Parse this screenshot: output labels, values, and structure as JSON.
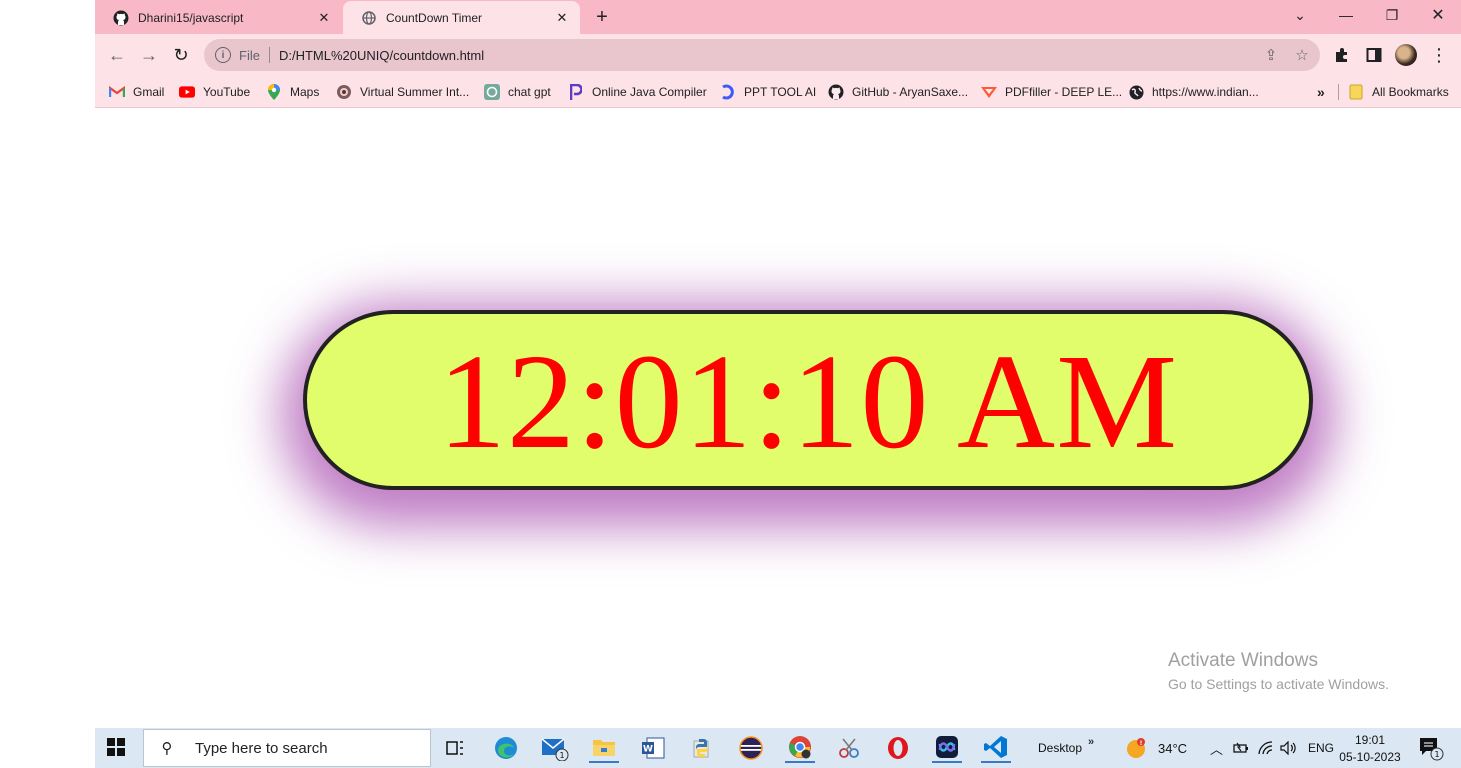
{
  "browser": {
    "tabs": [
      {
        "title": "Dharini15/javascript",
        "icon": "github-icon"
      },
      {
        "title": "CountDown Timer",
        "icon": "globe-icon"
      }
    ],
    "omnibox": {
      "scheme": "File",
      "url": "D:/HTML%20UNIQ/countdown.html"
    },
    "bookmarks": [
      {
        "label": "Gmail",
        "icon": "gmail-icon"
      },
      {
        "label": "YouTube",
        "icon": "youtube-icon"
      },
      {
        "label": "Maps",
        "icon": "maps-icon"
      },
      {
        "label": "Virtual Summer Int...",
        "icon": "site-icon"
      },
      {
        "label": "chat gpt",
        "icon": "openai-icon"
      },
      {
        "label": "Online Java Compiler",
        "icon": "programiz-icon"
      },
      {
        "label": "PPT TOOL AI",
        "icon": "ppt-tool-icon"
      },
      {
        "label": "GitHub - AryanSaxe...",
        "icon": "github-icon"
      },
      {
        "label": "PDFfiller - DEEP LE...",
        "icon": "pdffiller-icon"
      },
      {
        "label": "https://www.indian...",
        "icon": "globe-icon"
      }
    ],
    "all_bookmarks": "All Bookmarks"
  },
  "page": {
    "clock_time": "12:01:10 AM"
  },
  "watermark": {
    "title": "Activate Windows",
    "subtitle": "Go to Settings to activate Windows."
  },
  "taskbar": {
    "search_placeholder": "Type here to search",
    "desktop_label": "Desktop",
    "weather_temp": "34°C",
    "language": "ENG",
    "time": "19:01",
    "date": "05-10-2023",
    "notification_count": "1",
    "mail_badge": "1"
  },
  "colors": {
    "tabbar": "#f9b8c5",
    "toolbar": "#fde2e7",
    "clock_bg": "#e2fd6b",
    "clock_text": "#ff0000",
    "clock_glow": "#8c1496"
  }
}
